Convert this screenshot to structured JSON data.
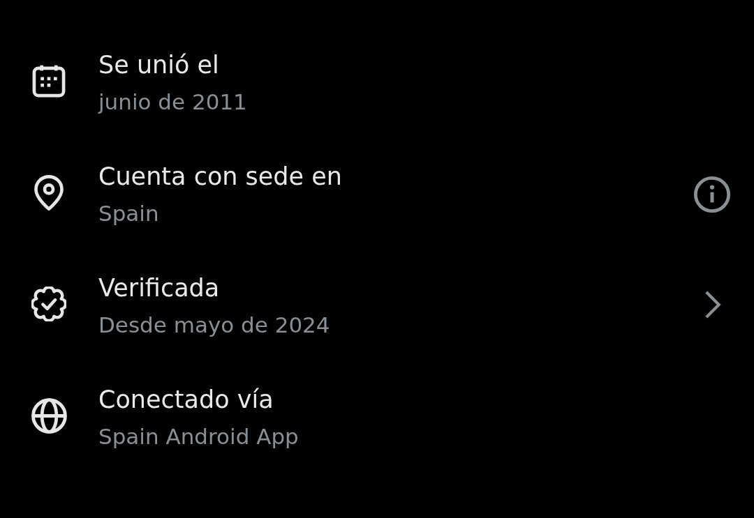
{
  "details": [
    {
      "kind": "plain",
      "title": "Se unió el",
      "subtitle": "junio de 2011"
    },
    {
      "kind": "info",
      "title": "Cuenta con sede en",
      "subtitle": "Spain"
    },
    {
      "kind": "link",
      "title": "Verificada",
      "subtitle": "Desde mayo de 2024"
    },
    {
      "kind": "plain",
      "title": "Conectado vía",
      "subtitle": "Spain Android App"
    }
  ]
}
